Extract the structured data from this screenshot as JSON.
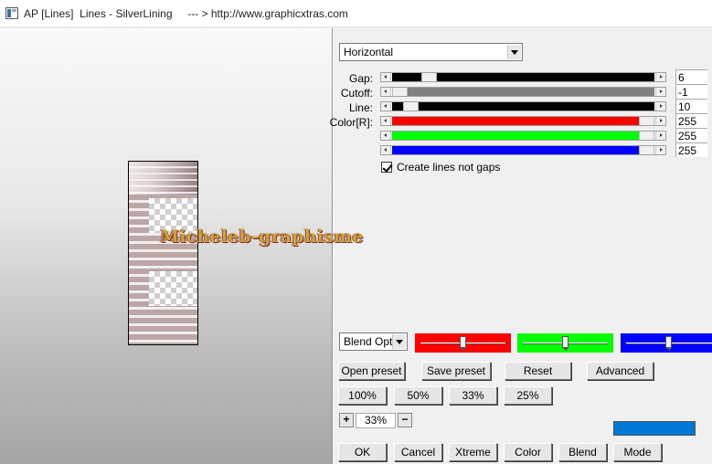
{
  "window": {
    "title": "AP [Lines]  Lines - SilverLining     --- > http://www.graphicxtras.com"
  },
  "preview": {
    "watermark": "Micheleb-graphisme"
  },
  "direction": {
    "value": "Horizontal"
  },
  "sliders": [
    {
      "label": "Gap:",
      "value": "6",
      "color": "#000000",
      "position": 0.15
    },
    {
      "label": "Cutoff:",
      "value": "-1",
      "color": "#808080",
      "position": 0.0
    },
    {
      "label": "Line:",
      "value": "10",
      "color": "#000000",
      "position": 0.06
    },
    {
      "label": "Color[R]:",
      "value": "255",
      "color": "#ff0000",
      "position": 1.0
    },
    {
      "label": "",
      "value": "255",
      "color": "#00ff00",
      "position": 1.0
    },
    {
      "label": "",
      "value": "255",
      "color": "#0000ff",
      "position": 1.0
    }
  ],
  "option": {
    "label": "Create lines not gaps",
    "checked": true
  },
  "blend": {
    "select_value": "Blend Optio",
    "color_bars": [
      {
        "color": "#ff0000",
        "position": 0.5
      },
      {
        "color": "#00ff00",
        "position": 0.5
      },
      {
        "color": "#0000ff",
        "position": 0.5
      }
    ]
  },
  "presets": {
    "open": "Open preset",
    "save": "Save preset",
    "reset": "Reset",
    "advanced": "Advanced"
  },
  "zoom_buttons": [
    "100%",
    "50%",
    "33%",
    "25%"
  ],
  "zoom": {
    "plus": "+",
    "value": "33%",
    "minus": "−"
  },
  "swatch_color": "#0078d7",
  "bottom_buttons": {
    "ok": "OK",
    "cancel": "Cancel",
    "xtreme": "Xtreme",
    "color": "Color",
    "blend": "Blend",
    "mode": "Mode"
  }
}
